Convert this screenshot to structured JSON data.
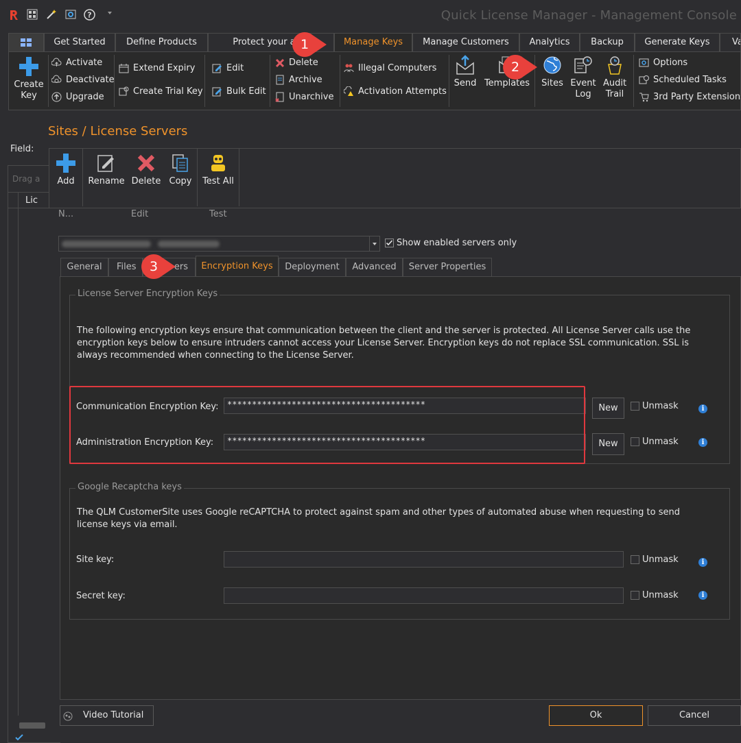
{
  "window": {
    "title": "Quick License Manager - Management Console"
  },
  "tabs": [
    {
      "label": ""
    },
    {
      "label": "Get Started"
    },
    {
      "label": "Define Products"
    },
    {
      "label": "Protect your appl"
    },
    {
      "label": "Manage Keys"
    },
    {
      "label": "Manage Customers"
    },
    {
      "label": "Analytics"
    },
    {
      "label": "Backup"
    },
    {
      "label": "Generate Keys"
    },
    {
      "label": "Va"
    }
  ],
  "ribbon": {
    "create_key": "Create\nKey",
    "activate": "Activate",
    "deactivate": "Deactivate",
    "upgrade": "Upgrade",
    "extend_expiry": "Extend Expiry",
    "create_trial_key": "Create Trial Key",
    "edit": "Edit",
    "bulk_edit": "Bulk Edit",
    "delete": "Delete",
    "archive": "Archive",
    "unarchive": "Unarchive",
    "illegal_computers": "Illegal Computers",
    "activation_attempts": "Activation Attempts",
    "send": "Send",
    "templates": "Templates",
    "sites": "Sites",
    "event_log": "Event\nLog",
    "audit_trail": "Audit\nTrail",
    "options": "Options",
    "scheduled_tasks": "Scheduled Tasks",
    "third_party": "3rd Party Extensions"
  },
  "left": {
    "field_label": "Field:",
    "drag_hint": "Drag a",
    "col_header": "Lic"
  },
  "dialog": {
    "title": "Sites / License Servers",
    "toolbar": {
      "add": "Add",
      "rename": "Rename",
      "delete": "Delete",
      "copy": "Copy",
      "test_all": "Test All"
    },
    "groups": {
      "new": "N...",
      "edit": "Edit",
      "test": "Test"
    },
    "show_enabled_label": "Show enabled servers only",
    "subtabs": [
      "General",
      "Files",
      "ers",
      "Encryption Keys",
      "Deployment",
      "Advanced",
      "Server Properties"
    ],
    "encryption": {
      "group_title": "License Server Encryption Keys",
      "description": "The following encryption keys ensure that communication between the client and the server is protected. All License Server calls use the encryption keys below to ensure intruders cannot access your License Server. Encryption keys do not replace SSL communication. SSL is always recommended when connecting to the License Server.",
      "comm_label": "Communication Encryption Key:",
      "comm_value": "****************************************",
      "admin_label": "Administration Encryption Key:",
      "admin_value": "****************************************",
      "new_label": "New",
      "unmask_label": "Unmask"
    },
    "recaptcha": {
      "group_title": "Google Recaptcha keys",
      "description": "The QLM CustomerSite uses Google reCAPTCHA to protect against spam and other types of automated abuse when requesting to send license keys via email.",
      "site_key_label": "Site key:",
      "secret_key_label": "Secret key:",
      "unmask_label": "Unmask"
    },
    "video_tutorial": "Video Tutorial",
    "ok": "Ok",
    "cancel": "Cancel"
  },
  "callouts": [
    "1",
    "2",
    "3"
  ],
  "colors": {
    "accent": "#f0932b",
    "highlight": "#e0383e",
    "callout": "#e8413c"
  }
}
